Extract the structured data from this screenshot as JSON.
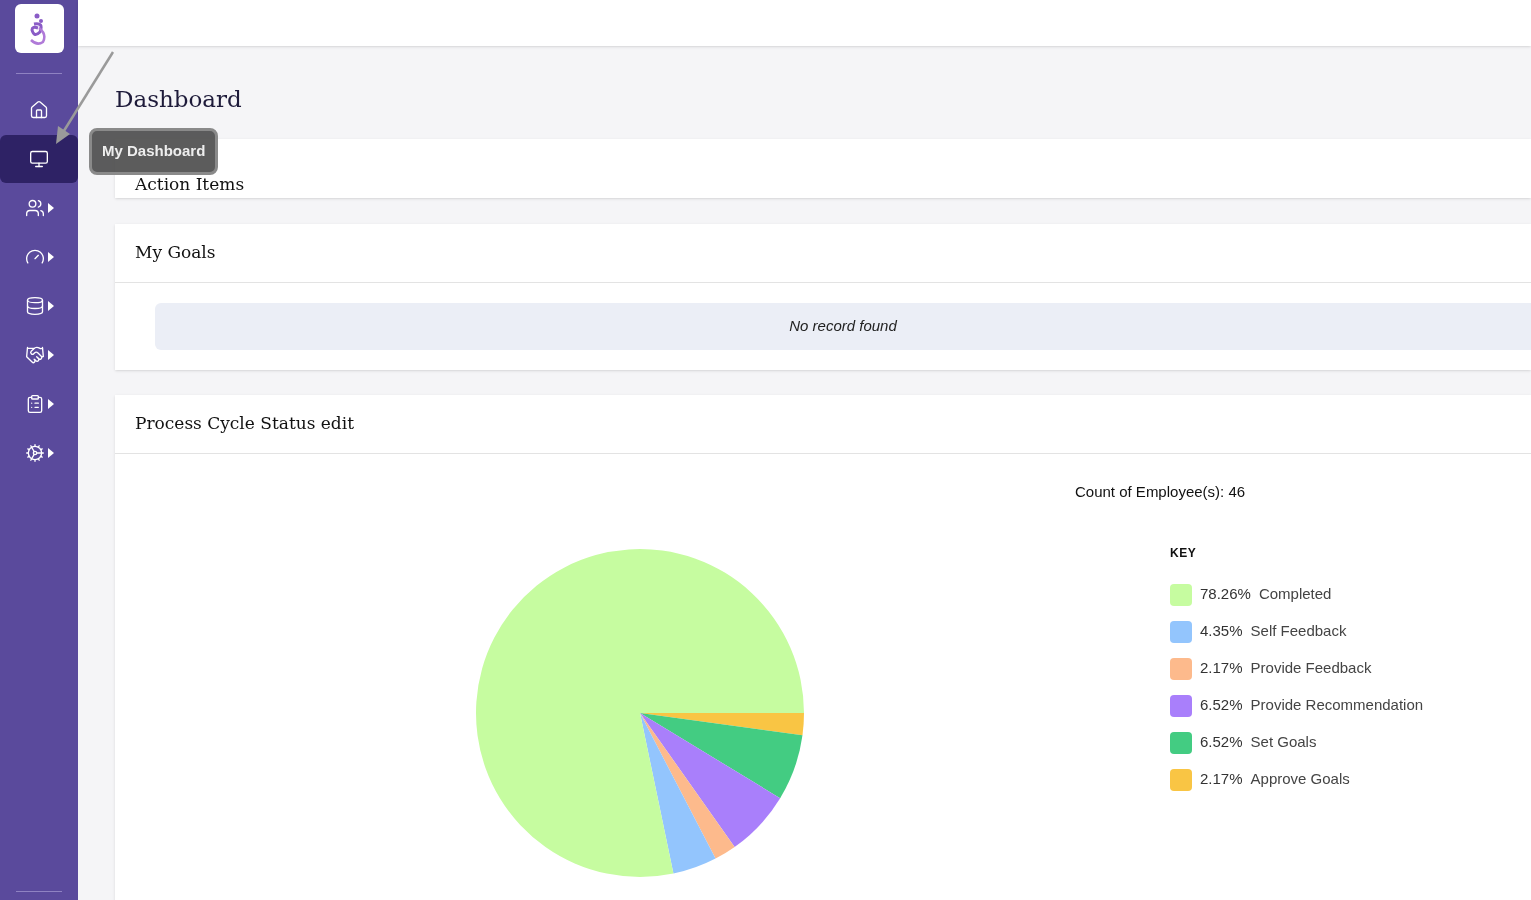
{
  "sidebar": {
    "items": [
      {
        "selected": false,
        "submenu": false
      },
      {
        "selected": true,
        "submenu": false
      },
      {
        "selected": false,
        "submenu": true
      },
      {
        "selected": false,
        "submenu": true
      },
      {
        "selected": false,
        "submenu": true
      },
      {
        "selected": false,
        "submenu": true
      },
      {
        "selected": false,
        "submenu": true
      },
      {
        "selected": false,
        "submenu": true
      }
    ]
  },
  "tooltip": "My Dashboard",
  "page_title": "Dashboard",
  "action_items": {
    "title": "Action Items"
  },
  "my_goals": {
    "title": "My Goals",
    "empty_message": "No record found"
  },
  "process_cycle": {
    "title": "Process Cycle Status edit",
    "count": "Count of Employee(s): 46",
    "legend_title": "KEY",
    "legend": [
      {
        "percent": "78.26%",
        "label": "Completed",
        "color": "#c6fca0"
      },
      {
        "percent": "4.35%",
        "label": "Self Feedback",
        "color": "#93c5fd"
      },
      {
        "percent": "2.17%",
        "label": "Provide Feedback",
        "color": "#fdba8c"
      },
      {
        "percent": "6.52%",
        "label": "Provide Recommendation",
        "color": "#a97ffb"
      },
      {
        "percent": "6.52%",
        "label": "Set Goals",
        "color": "#43cc82"
      },
      {
        "percent": "2.17%",
        "label": "Approve Goals",
        "color": "#f9c544"
      }
    ],
    "chart_data": {
      "type": "pie",
      "values": [
        78.26,
        4.35,
        2.17,
        6.52,
        6.52,
        2.17
      ]
    }
  }
}
